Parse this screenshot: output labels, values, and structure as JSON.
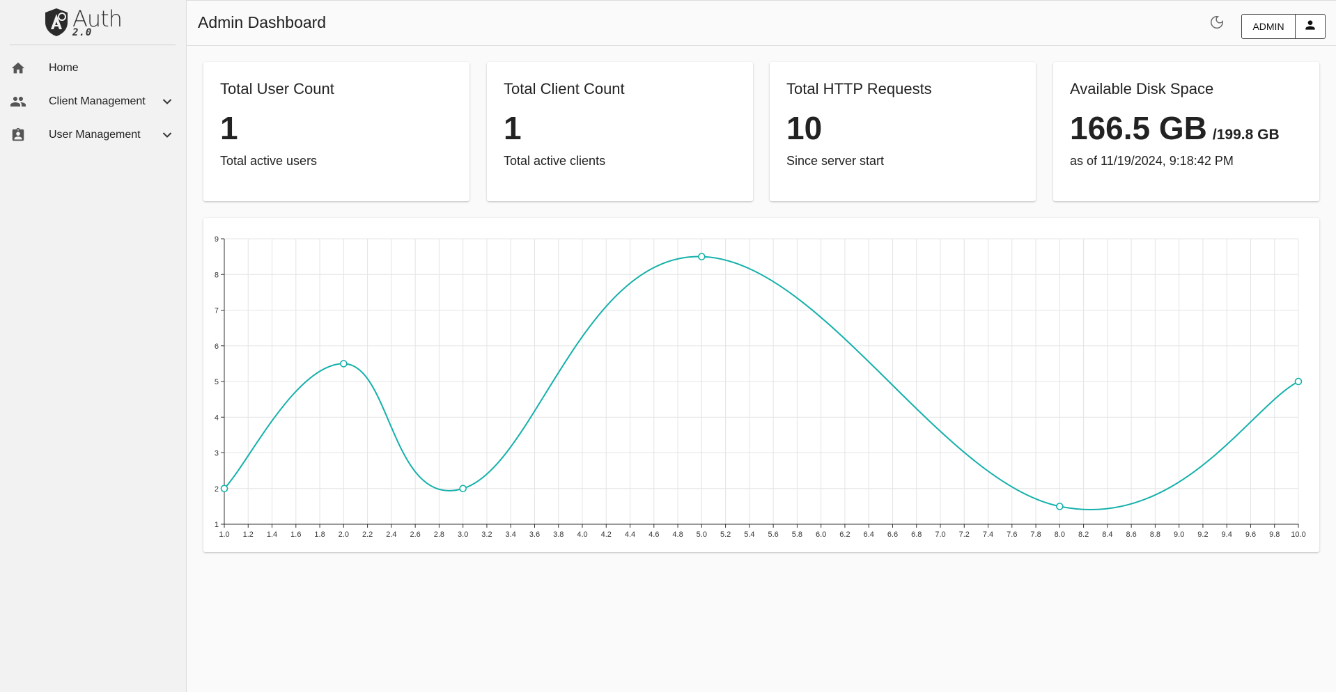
{
  "app": {
    "logo_main": "Auth",
    "logo_sub": "2.0"
  },
  "sidebar": {
    "items": [
      {
        "label": "Home",
        "icon": "home-icon",
        "expandable": false
      },
      {
        "label": "Client Management",
        "icon": "people-icon",
        "expandable": true
      },
      {
        "label": "User Management",
        "icon": "badge-icon",
        "expandable": true
      }
    ]
  },
  "header": {
    "title": "Admin Dashboard",
    "theme_icon": "moon-icon",
    "admin_label": "ADMIN",
    "user_icon": "person-icon"
  },
  "cards": [
    {
      "title": "Total User Count",
      "value": "1",
      "value_sub": "",
      "caption": "Total active users"
    },
    {
      "title": "Total Client Count",
      "value": "1",
      "value_sub": "",
      "caption": "Total active clients"
    },
    {
      "title": "Total HTTP Requests",
      "value": "10",
      "value_sub": "",
      "caption": "Since server start"
    },
    {
      "title": "Available Disk Space",
      "value": "166.5 GB",
      "value_sub": "/199.8 GB",
      "caption": "as of 11/19/2024, 9:18:42 PM"
    }
  ],
  "colors": {
    "accent": "#14b0aa",
    "grid": "#e4e4e4"
  },
  "chart_data": {
    "type": "line",
    "curve": "smooth",
    "title": "",
    "xlabel": "",
    "ylabel": "",
    "xlim": [
      1.0,
      10.0
    ],
    "ylim": [
      1,
      9
    ],
    "x_ticks": [
      "1.0",
      "1.2",
      "1.4",
      "1.6",
      "1.8",
      "2.0",
      "2.2",
      "2.4",
      "2.6",
      "2.8",
      "3.0",
      "3.2",
      "3.4",
      "3.6",
      "3.8",
      "4.0",
      "4.2",
      "4.4",
      "4.6",
      "4.8",
      "5.0",
      "5.2",
      "5.4",
      "5.6",
      "5.8",
      "6.0",
      "6.2",
      "6.4",
      "6.6",
      "6.8",
      "7.0",
      "7.2",
      "7.4",
      "7.6",
      "7.8",
      "8.0",
      "8.2",
      "8.4",
      "8.6",
      "8.8",
      "9.0",
      "9.2",
      "9.4",
      "9.6",
      "9.8",
      "10.0"
    ],
    "y_ticks": [
      "1",
      "2",
      "3",
      "4",
      "5",
      "6",
      "7",
      "8",
      "9"
    ],
    "grid": true,
    "series": [
      {
        "x": [
          1,
          2,
          3,
          5,
          8,
          10
        ],
        "y": [
          2,
          5.5,
          2,
          8.5,
          1.5,
          5
        ]
      }
    ]
  }
}
